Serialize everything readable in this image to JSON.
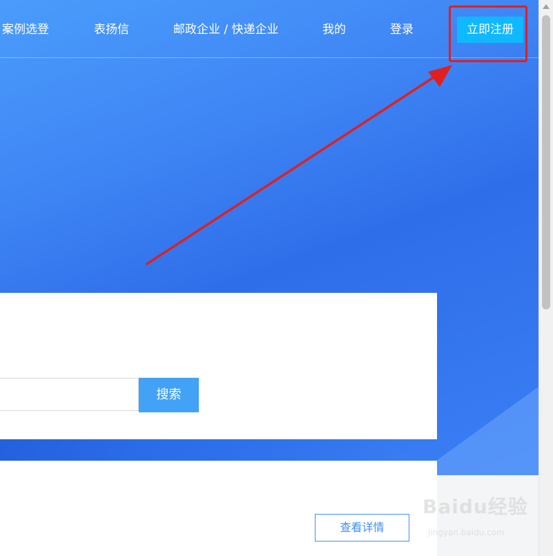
{
  "nav": {
    "items": [
      {
        "label": "案例选登"
      },
      {
        "label": "表扬信"
      },
      {
        "label": "邮政企业 / 快递企业"
      },
      {
        "label": "我的"
      },
      {
        "label": "登录"
      }
    ],
    "register_label": "立即注册"
  },
  "search": {
    "value": "",
    "placeholder": "",
    "button_label": "搜索"
  },
  "detail": {
    "button_label": "查看详情"
  },
  "annotation": {
    "color": "#e02020"
  },
  "watermark": {
    "logo": "Baidu经验",
    "url": "jingyan.baidu.com"
  },
  "colors": {
    "hero_blue": "#3f86f5",
    "register_cyan": "#10b8ff",
    "search_button": "#42a2f6",
    "detail_border": "#3f8ef3"
  }
}
